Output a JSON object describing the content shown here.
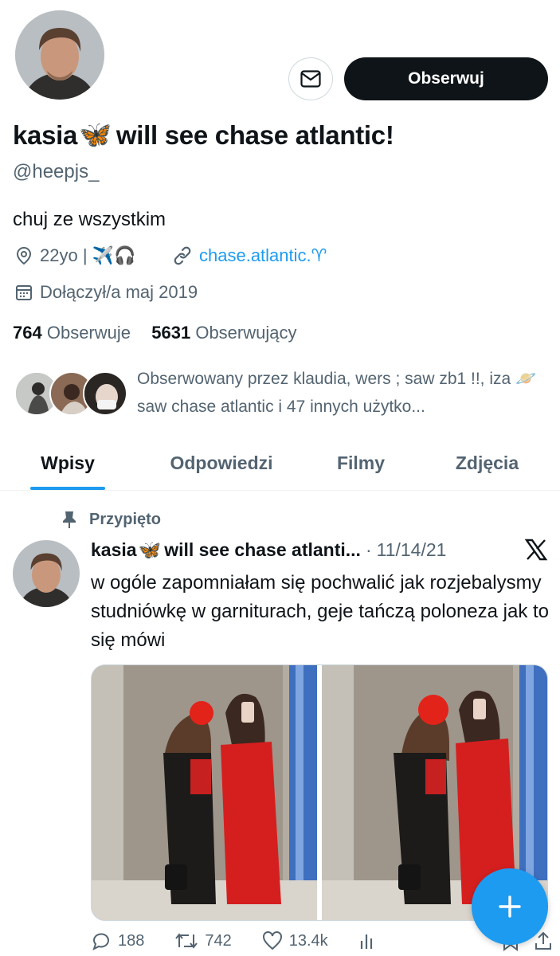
{
  "profile": {
    "display_name_part1": "kasia",
    "display_name_emoji": "🦋",
    "display_name_part2": "will see chase atlantic!",
    "handle": "@heepjs_",
    "bio": "chuj ze wszystkim",
    "location": "22yo | ✈️🎧",
    "website": "chase.atlantic.♈︎",
    "joined": "Dołączył/a maj 2019",
    "following_count": "764",
    "following_label": "Obserwuje",
    "followers_count": "5631",
    "followers_label": "Obserwujący",
    "followed_by_text": "Obserwowany przez klaudia, wers ; saw zb1 !!, iza 🪐 saw chase atlantic i 47 innych użytko..."
  },
  "buttons": {
    "follow": "Obserwuj",
    "message_icon": "mail-icon"
  },
  "tabs": [
    {
      "label": "Wpisy",
      "active": true
    },
    {
      "label": "Odpowiedzi",
      "active": false
    },
    {
      "label": "Filmy",
      "active": false
    },
    {
      "label": "Zdjęcia",
      "active": false
    }
  ],
  "tweet": {
    "pinned_label": "Przypięto",
    "author_part1": "kasia",
    "author_emoji": "🦋",
    "author_part2": "will see chase atlanti...",
    "separator": "·",
    "date": "11/14/21",
    "text": "w ogóle zapomniałam się pochwalić jak rozjebalysmy studniówkę w garniturach, geje tańczą poloneza jak to się mówi",
    "replies": "188",
    "retweets": "742",
    "likes": "13.4k"
  },
  "colors": {
    "accent": "#1d9bf0",
    "text": "#0f1419",
    "secondary": "#536471",
    "follow_bg": "#0f1419"
  }
}
